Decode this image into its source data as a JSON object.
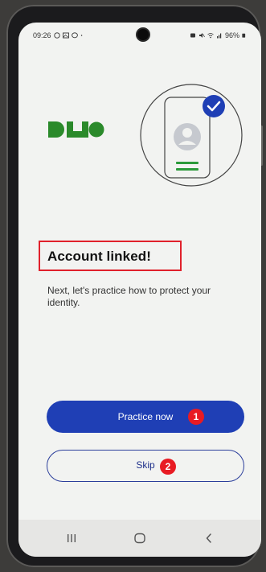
{
  "status_bar": {
    "time": "09:26",
    "battery": "96%"
  },
  "icons": {
    "status_left": [
      "whatsapp-icon",
      "gallery-icon",
      "messenger-icon",
      "dot-icon"
    ],
    "status_right": [
      "alarm-icon",
      "mute-icon",
      "wifi-icon",
      "signal-icon",
      "battery-icon"
    ]
  },
  "brand": {
    "logo_text": "DUO",
    "color": "#2b8a2b"
  },
  "content": {
    "title": "Account linked!",
    "description": "Next, let's practice how to protect your identity."
  },
  "buttons": {
    "practice_label": "Practice now",
    "skip_label": "Skip"
  },
  "annotations": {
    "badge_1": "1",
    "badge_2": "2"
  },
  "colors": {
    "primary_button": "#1f3fb5",
    "annotation_red": "#e81b23",
    "check_blue": "#1f3fb5",
    "screen_bg": "#f2f3f1"
  },
  "navigation": {
    "recents": "recents-icon",
    "home": "home-icon",
    "back": "back-icon"
  }
}
